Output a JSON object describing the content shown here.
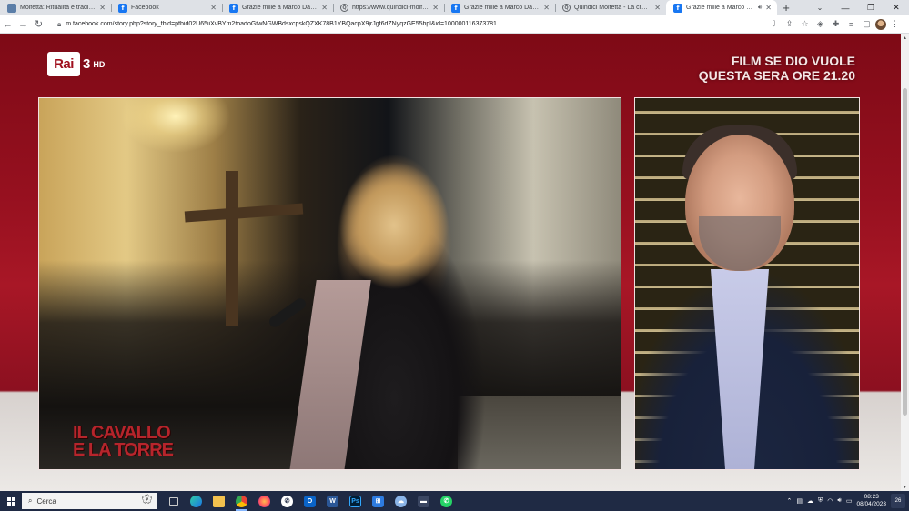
{
  "browser": {
    "tabs": [
      {
        "title": "Molfetta: Ritualità e tradizione p",
        "favicon": "site",
        "active": false
      },
      {
        "title": "Facebook",
        "favicon": "fb",
        "active": false
      },
      {
        "title": "Grazie mille a Marco Damilano",
        "favicon": "fb",
        "active": false
      },
      {
        "title": "https://www.quindici-molfetta.it",
        "favicon": "web",
        "active": false
      },
      {
        "title": "Grazie mille a Marco Damilano",
        "favicon": "fb",
        "active": false
      },
      {
        "title": "Quindici Molfetta - La croce de",
        "favicon": "web",
        "active": false
      },
      {
        "title": "Grazie mille a Marco Damilano",
        "favicon": "fb",
        "active": true,
        "audio": true
      }
    ],
    "new_tab_label": "+",
    "url": "m.facebook.com/story.php?story_fbid=pfbid02U65iiXvBYm2toadoGtwNGWBdsxcpskQZXK78B1YBQacpX9jrJgf6dZNyqzGE55bpl&id=100000116373781"
  },
  "video": {
    "channel": "Rai",
    "channel_number": "3",
    "channel_suffix": "HD",
    "promo_line1": "FILM SE DIO VUOLE",
    "promo_line2": "QUESTA SERA ORE 21.20",
    "show_logo_line1": "IL CAVALLO",
    "show_logo_line2": "E LA TORRE"
  },
  "taskbar": {
    "search_placeholder": "Cerca",
    "time": "08:23",
    "date": "08/04/2023",
    "notification_count": "26"
  },
  "colors": {
    "facebook": "#1877f2",
    "rai_red": "#a0101e",
    "taskbar": "#1f2a44"
  }
}
